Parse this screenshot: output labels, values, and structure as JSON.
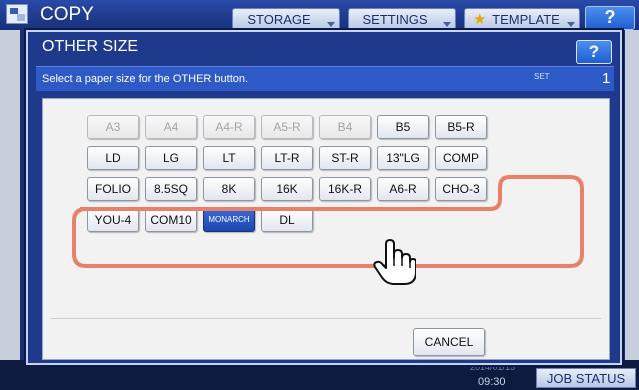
{
  "app": {
    "title": "COPY"
  },
  "top_tabs": [
    {
      "label": "STORAGE"
    },
    {
      "label": "SETTINGS"
    },
    {
      "label": "TEMPLATE"
    }
  ],
  "help_label": "?",
  "dialog": {
    "title": "OTHER SIZE",
    "help_label": "?",
    "instruction": "Select a paper size for the OTHER button.",
    "set_label": "SET",
    "set_count": "1",
    "cancel_label": "CANCEL"
  },
  "size_buttons": [
    {
      "label": "A3",
      "state": "disabled"
    },
    {
      "label": "A4",
      "state": "disabled"
    },
    {
      "label": "A4-R",
      "state": "disabled"
    },
    {
      "label": "A5-R",
      "state": "disabled"
    },
    {
      "label": "B4",
      "state": "disabled"
    },
    {
      "label": "B5",
      "state": "normal"
    },
    {
      "label": "B5-R",
      "state": "normal"
    },
    {
      "label": "LD",
      "state": "normal"
    },
    {
      "label": "LG",
      "state": "normal"
    },
    {
      "label": "LT",
      "state": "normal"
    },
    {
      "label": "LT-R",
      "state": "normal"
    },
    {
      "label": "ST-R",
      "state": "normal"
    },
    {
      "label": "13\"LG",
      "state": "normal"
    },
    {
      "label": "COMP",
      "state": "normal"
    },
    {
      "label": "FOLIO",
      "state": "normal"
    },
    {
      "label": "8.5SQ",
      "state": "normal"
    },
    {
      "label": "8K",
      "state": "normal"
    },
    {
      "label": "16K",
      "state": "normal"
    },
    {
      "label": "16K-R",
      "state": "normal"
    },
    {
      "label": "A6-R",
      "state": "normal"
    },
    {
      "label": "CHO-3",
      "state": "normal"
    },
    {
      "label": "YOU-4",
      "state": "normal"
    },
    {
      "label": "COM10",
      "state": "normal"
    },
    {
      "label": "MONARCH",
      "state": "selected"
    },
    {
      "label": "DL",
      "state": "normal"
    }
  ],
  "status": {
    "time_small": "2014/01/15",
    "time": "09:30",
    "job_status": "JOB STATUS"
  },
  "colors": {
    "accent": "#1f3a8c",
    "selected": "#1b47b2",
    "highlight": "#e8806a"
  }
}
